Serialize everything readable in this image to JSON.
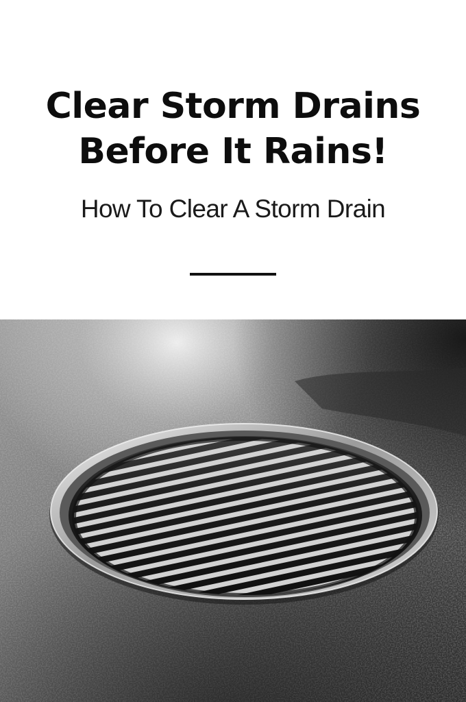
{
  "pin": {
    "title_line_1": "Clear Storm Drains",
    "title_line_2": "Before It Rains!",
    "subtitle": "How To Clear A Storm Drain"
  },
  "photo": {
    "subject": "storm-drain-grate-photo"
  }
}
